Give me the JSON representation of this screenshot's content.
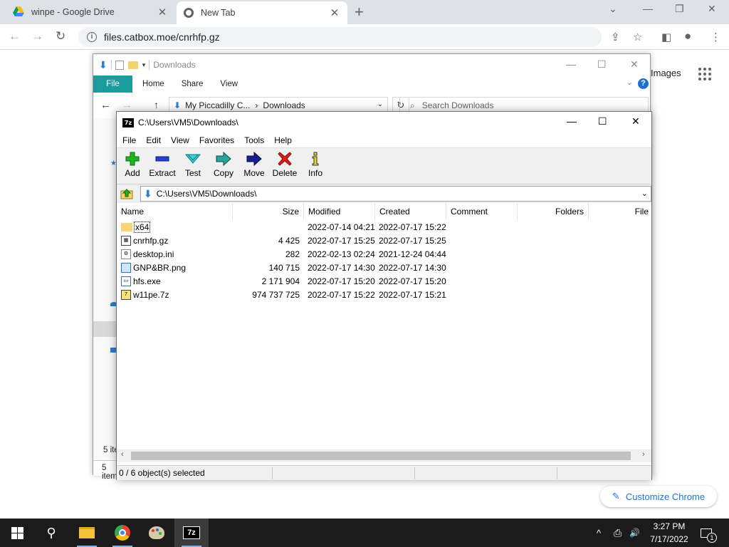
{
  "browser": {
    "tabs": [
      {
        "title": "winpe - Google Drive",
        "close": "✕"
      },
      {
        "title": "New Tab",
        "close": "✕"
      }
    ],
    "new_tab": "+",
    "window_controls": {
      "minimize": "⌄",
      "min": "—",
      "restore": "❐",
      "close": "✕"
    },
    "nav": {
      "back": "←",
      "forward": "→",
      "reload": "↻"
    },
    "url": "files.catbox.moe/cnrhfp.gz",
    "info_glyph": "i",
    "toolbar": {
      "share": "⇪",
      "star": "☆",
      "sidepanel": "◧",
      "profile": "●",
      "menu": "⋮"
    }
  },
  "page": {
    "images_link": "Images",
    "customize_label": "Customize Chrome",
    "pencil": "✎"
  },
  "explorer": {
    "title": "Downloads",
    "window_controls": {
      "min": "—",
      "max": "☐",
      "close": "✕"
    },
    "ribbon": {
      "file": "File",
      "tabs": [
        "Home",
        "Share",
        "View"
      ],
      "chevron": "⌄",
      "help": "?"
    },
    "address": {
      "crumb1": "My Piccadilly C...",
      "crumb_sep": "›",
      "crumb2": "Downloads",
      "dropdown": "⌄"
    },
    "refresh": "↻",
    "search_placeholder": "Search Downloads",
    "search_glyph": "⌕",
    "status1": "5 ite",
    "status2": "5 item"
  },
  "sevenzip": {
    "title": "C:\\Users\\VM5\\Downloads\\",
    "logo": "7z",
    "window_controls": {
      "min": "—",
      "max": "☐",
      "close": "✕"
    },
    "menu": [
      "File",
      "Edit",
      "View",
      "Favorites",
      "Tools",
      "Help"
    ],
    "toolbar": [
      {
        "label": "Add"
      },
      {
        "label": "Extract"
      },
      {
        "label": "Test"
      },
      {
        "label": "Copy"
      },
      {
        "label": "Move"
      },
      {
        "label": "Delete"
      },
      {
        "label": "Info"
      }
    ],
    "path": "C:\\Users\\VM5\\Downloads\\",
    "path_dropdown": "⌄",
    "columns": [
      "Name",
      "Size",
      "Modified",
      "Created",
      "Comment",
      "Folders",
      "File"
    ],
    "files": [
      {
        "name": "x64",
        "size": "",
        "modified": "2022-07-14 04:21",
        "created": "2022-07-17 15:22",
        "icon": "folder-icon"
      },
      {
        "name": "cnrhfp.gz",
        "size": "4 425",
        "modified": "2022-07-17 15:25",
        "created": "2022-07-17 15:25",
        "icon": "archive-file-icon"
      },
      {
        "name": "desktop.ini",
        "size": "282",
        "modified": "2022-02-13 02:24",
        "created": "2021-12-24 04:44",
        "icon": "settings-file-icon"
      },
      {
        "name": "GNP&BR.png",
        "size": "140 715",
        "modified": "2022-07-17 14:30",
        "created": "2022-07-17 14:30",
        "icon": "image-file-icon"
      },
      {
        "name": "hfs.exe",
        "size": "2 171 904",
        "modified": "2022-07-17 15:20",
        "created": "2022-07-17 15:20",
        "icon": "exe-file-icon"
      },
      {
        "name": "w11pe.7z",
        "size": "974 737 725",
        "modified": "2022-07-17 15:22",
        "created": "2022-07-17 15:21",
        "icon": "7z-file-icon"
      }
    ],
    "scroll": {
      "left": "‹",
      "right": "›"
    },
    "status": "0 / 6 object(s) selected"
  },
  "taskbar": {
    "search_glyph": "⚲",
    "time": "3:27 PM",
    "date": "7/17/2022",
    "sevenzip_label": "7z",
    "tray": {
      "chevron": "^",
      "network": "⎙",
      "volume": "🔊",
      "notifications": "1"
    }
  }
}
